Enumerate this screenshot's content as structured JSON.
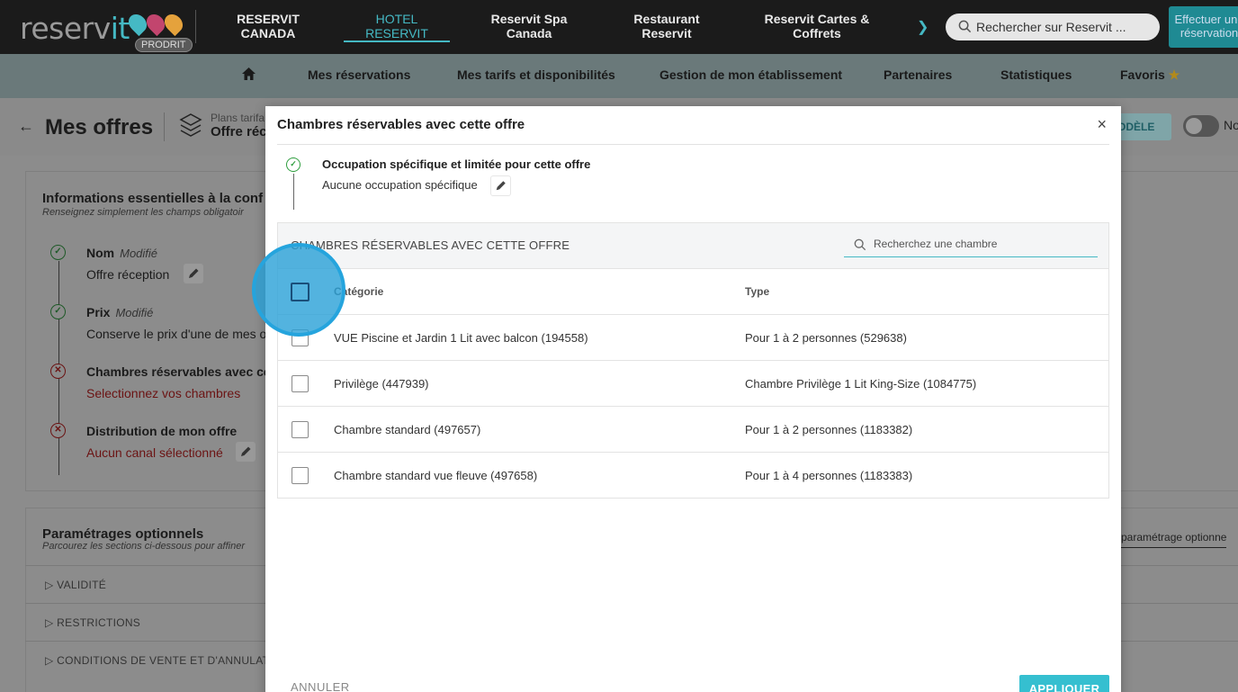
{
  "brand": {
    "logo_text_1": "reserv",
    "logo_text_2": "it",
    "badge": "PRODRIT"
  },
  "topnav": [
    {
      "label": "RESERVIT\nCANADA"
    },
    {
      "label": "HOTEL\nRESERVIT",
      "active": true
    },
    {
      "label": "Reservit Spa\nCanada"
    },
    {
      "label": "Restaurant\nReservit"
    },
    {
      "label": "Reservit Cartes &\nCoffrets"
    }
  ],
  "top_search": {
    "placeholder": "Rechercher sur Reservit ..."
  },
  "top_button": {
    "label": "Effectuer une\nréservation"
  },
  "subnav": {
    "items": [
      "Mes réservations",
      "Mes tarifs et disponibilités",
      "Gestion de mon établissement",
      "Partenaires",
      "Statistiques",
      "Favoris"
    ]
  },
  "page_header": {
    "title": "Mes offres",
    "plans_small": "Plans tarifa",
    "plans_big": "Offre réc",
    "modele_label": "ODÈLE",
    "no_label": "No"
  },
  "essentials": {
    "title": "Informations essentielles à la conf",
    "subtitle": "Renseignez simplement les champs obligatoir",
    "steps": [
      {
        "label": "Nom",
        "modified": "Modifié",
        "value": "Offre réception",
        "status": "ok"
      },
      {
        "label": "Prix",
        "modified": "Modifié",
        "value": "Conserve le prix d'une de mes of",
        "status": "ok"
      },
      {
        "label": "Chambres réservables avec cet",
        "modified": "",
        "value": "Selectionnez vos chambres",
        "status": "err"
      },
      {
        "label": "Distribution de mon offre",
        "modified": "",
        "value": "Aucun canal sélectionné",
        "status": "err"
      }
    ]
  },
  "optional": {
    "title": "Paramétrages optionnels",
    "subtitle": "Parcourez les sections ci-dessous pour affiner",
    "link": "paramétrage optionne",
    "sections": [
      "VALIDITÉ",
      "RESTRICTIONS",
      "CONDITIONS DE VENTE ET D'ANNULAT"
    ]
  },
  "modal": {
    "title": "Chambres réservables avec cette offre",
    "close": "×",
    "occupancy_title": "Occupation spécifique et limitée pour cette offre",
    "occupancy_value": "Aucune occupation spécifique",
    "table_heading": "CHAMBRES RÉSERVABLES AVEC CETTE OFFRE",
    "search_placeholder": "Recherchez une chambre",
    "columns": {
      "category": "Catégorie",
      "type": "Type"
    },
    "rows": [
      {
        "category": "VUE Piscine et Jardin 1 Lit avec balcon (194558)",
        "type": "Pour 1 à 2 personnes (529638)"
      },
      {
        "category": "Privilège (447939)",
        "type": "Chambre Privilège 1 Lit King-Size (1084775)"
      },
      {
        "category": "Chambre standard (497657)",
        "type": "Pour 1 à 2 personnes (1183382)"
      },
      {
        "category": "Chambre standard vue fleuve (497658)",
        "type": "Pour 1 à 4 personnes (1183383)"
      }
    ],
    "cancel_label": "ANNULER",
    "apply_label": "APPLIQUER"
  },
  "colors": {
    "accent": "#45b9c4",
    "apply": "#35bfd0",
    "ok": "#2e9e3e",
    "error": "#c62828",
    "highlight": "#25a4dd"
  }
}
